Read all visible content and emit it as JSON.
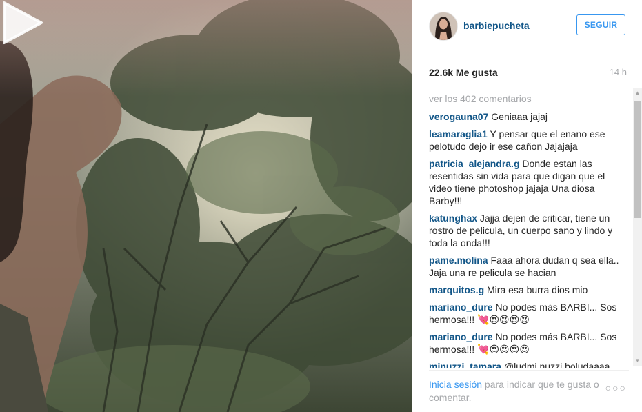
{
  "post": {
    "username": "barbiepucheta",
    "follow_label": "SEGUIR",
    "likes": "22.6k Me gusta",
    "timestamp": "14 h",
    "load_more_comments": "ver los 402 comentarios"
  },
  "comments": [
    {
      "user": "verogauna07",
      "text": "Geniaaa jajaj"
    },
    {
      "user": "leamaraglia1",
      "text": "Y pensar que el enano ese pelotudo dejo ir ese cañon Jajajaja"
    },
    {
      "user": "patricia_alejandra.g",
      "text": "Donde estan las resentidas sin vida para que digan que el video tiene photoshop jajaja Una diosa Barby!!!"
    },
    {
      "user": "katunghax",
      "text": "Jajja dejen de criticar, tiene un rostro de pelicula, un cuerpo sano y lindo y toda la onda!!!"
    },
    {
      "user": "pame.molina",
      "text": "Faaa ahora dudan q sea ella.. Jaja una re pelicula se hacian"
    },
    {
      "user": "marquitos.g",
      "text": "Mira esa burra dios mio"
    },
    {
      "user": "mariano_dure",
      "text": "No podes más BARBI... Sos hermosa!!! 💘😍😍😍😍"
    },
    {
      "user": "mariano_dure",
      "text": "No podes más BARBI... Sos hermosa!!! 💘😍😍😍😍"
    },
    {
      "user": "minuzzi_tamara",
      "text": "@ludmi.nuzzi boludaaaa"
    }
  ],
  "footer": {
    "login_link": "Inicia sesión",
    "rest": " para indicar que te gusta o comentar.",
    "more": "○○○"
  },
  "colors": {
    "username_blue": "#125688",
    "button_blue": "#3897f0",
    "muted_gray": "#a5a7aa"
  },
  "icons": {
    "play": "play-icon",
    "options": "more-options-icon"
  }
}
